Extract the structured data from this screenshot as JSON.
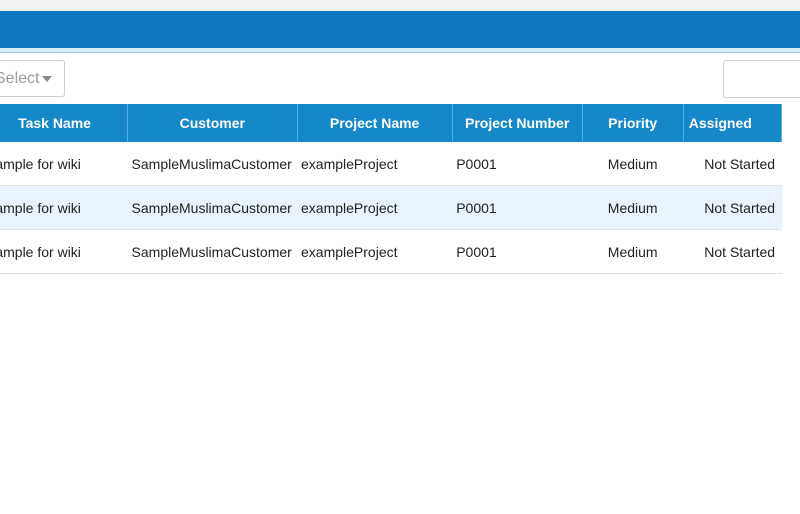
{
  "toolbar": {
    "select_value": "Select",
    "search_placeholder": ""
  },
  "table": {
    "headers": [
      "Task Name",
      "Customer",
      "Project Name",
      "Project Number",
      "Priority",
      "Assigned"
    ],
    "rows": [
      [
        "Sample for wiki",
        "SampleMuslimaCustomer",
        "exampleProject",
        "P0001",
        "Medium",
        "Not Started"
      ],
      [
        "Sample for wiki",
        "SampleMuslimaCustomer",
        "exampleProject",
        "P0001",
        "Medium",
        "Not Started"
      ],
      [
        "Sample for wiki",
        "SampleMuslimaCustomer",
        "exampleProject",
        "P0001",
        "Medium",
        "Not Started"
      ]
    ]
  },
  "colors": {
    "app_bar": "#0b78c0",
    "header_bg": "#1588c9",
    "alt_row": "#e8f3fd"
  }
}
